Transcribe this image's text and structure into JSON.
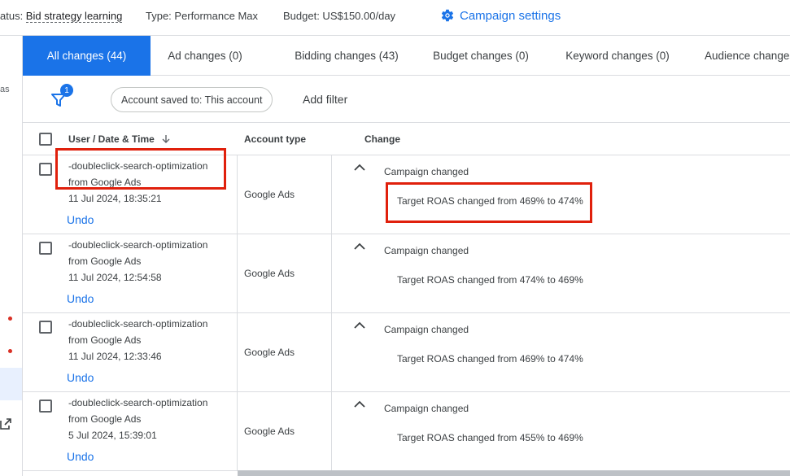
{
  "topbar": {
    "status_label": "atus: ",
    "status_value": "Bid strategy learning",
    "type": "Type: Performance Max",
    "budget": "Budget: US$150.00/day",
    "settings_label": "Campaign settings"
  },
  "leftrail": {
    "fragment": "as"
  },
  "tabs": [
    {
      "label": "All changes (44)"
    },
    {
      "label": "Ad changes (0)"
    },
    {
      "label": "Bidding changes (43)"
    },
    {
      "label": "Budget changes (0)"
    },
    {
      "label": "Keyword changes (0)"
    },
    {
      "label": "Audience changes"
    }
  ],
  "filters": {
    "badge": "1",
    "chip": "Account saved to: This account",
    "add_filter": "Add filter"
  },
  "table": {
    "headers": {
      "user": "User / Date & Time",
      "account_type": "Account type",
      "change": "Change"
    },
    "rows": [
      {
        "user_line1": "-doubleclick-search-optimization",
        "user_line2": "from Google Ads",
        "datetime": "11 Jul 2024, 18:35:21",
        "undo": "Undo",
        "account_type": "Google Ads",
        "change_title": "Campaign changed",
        "change_detail": "Target ROAS changed from 469% to 474%"
      },
      {
        "user_line1": "-doubleclick-search-optimization",
        "user_line2": "from Google Ads",
        "datetime": "11 Jul 2024, 12:54:58",
        "undo": "Undo",
        "account_type": "Google Ads",
        "change_title": "Campaign changed",
        "change_detail": "Target ROAS changed from 474% to 469%"
      },
      {
        "user_line1": "-doubleclick-search-optimization",
        "user_line2": "from Google Ads",
        "datetime": "11 Jul 2024, 12:33:46",
        "undo": "Undo",
        "account_type": "Google Ads",
        "change_title": "Campaign changed",
        "change_detail": "Target ROAS changed from 469% to 474%"
      },
      {
        "user_line1": "-doubleclick-search-optimization",
        "user_line2": "from Google Ads",
        "datetime": "5 Jul 2024, 15:39:01",
        "undo": "Undo",
        "account_type": "Google Ads",
        "change_title": "Campaign changed",
        "change_detail": "Target ROAS changed from 455% to 469%"
      }
    ]
  },
  "colors": {
    "accent": "#1a73e8",
    "highlight_box": "#e0200c"
  },
  "icons": [
    "gear-icon",
    "filter-icon",
    "sort-arrow-down-icon",
    "chevron-up-icon",
    "external-link-icon"
  ]
}
